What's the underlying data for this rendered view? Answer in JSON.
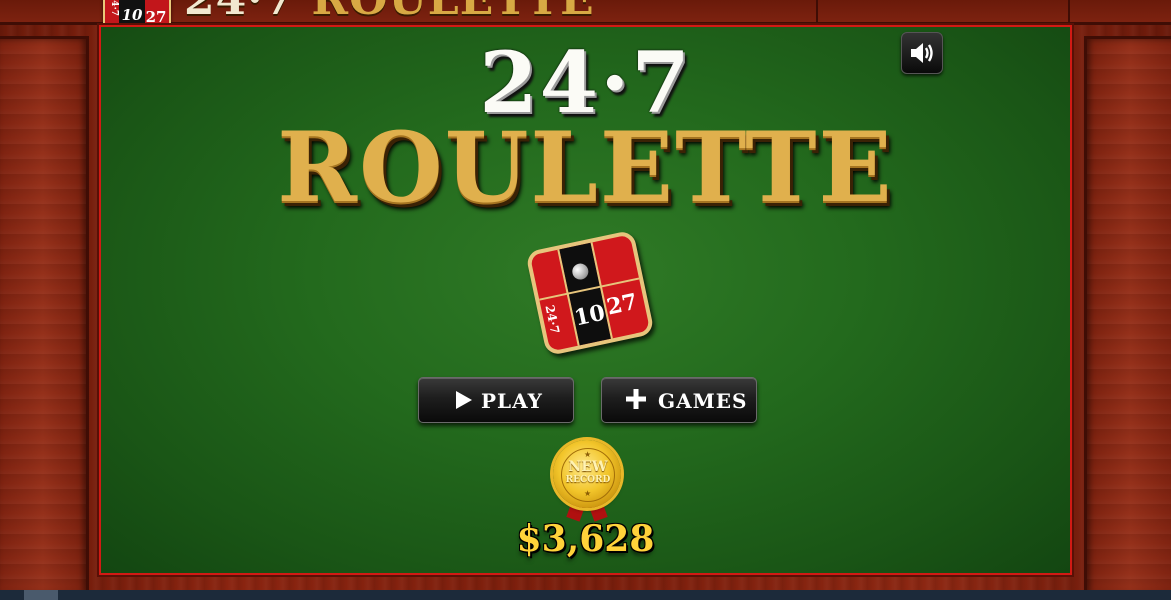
{
  "header": {
    "title_left": "24·7",
    "title_right": "ROULETTE",
    "logo": {
      "n247": "24·7",
      "n10": "10",
      "n27": "27"
    }
  },
  "main": {
    "title_line1": "24·7",
    "title_line2": "ROULETTE",
    "logo": {
      "n247": "24·7",
      "n10": "10",
      "n27": "27"
    },
    "play_label": "PLAY",
    "games_label": "GAMES",
    "badge_line1": "NEW",
    "badge_line2": "RECORD",
    "record_value": "$3,628"
  },
  "icons": {
    "sound": "speaker-volume-icon",
    "play": "play-triangle-icon",
    "games": "plus-icon",
    "badge": "award-seal-icon"
  },
  "colors": {
    "felt": "#236a1d",
    "gold": "#e0b04d",
    "record": "#ffd23a",
    "felt_border": "#d21a14"
  }
}
